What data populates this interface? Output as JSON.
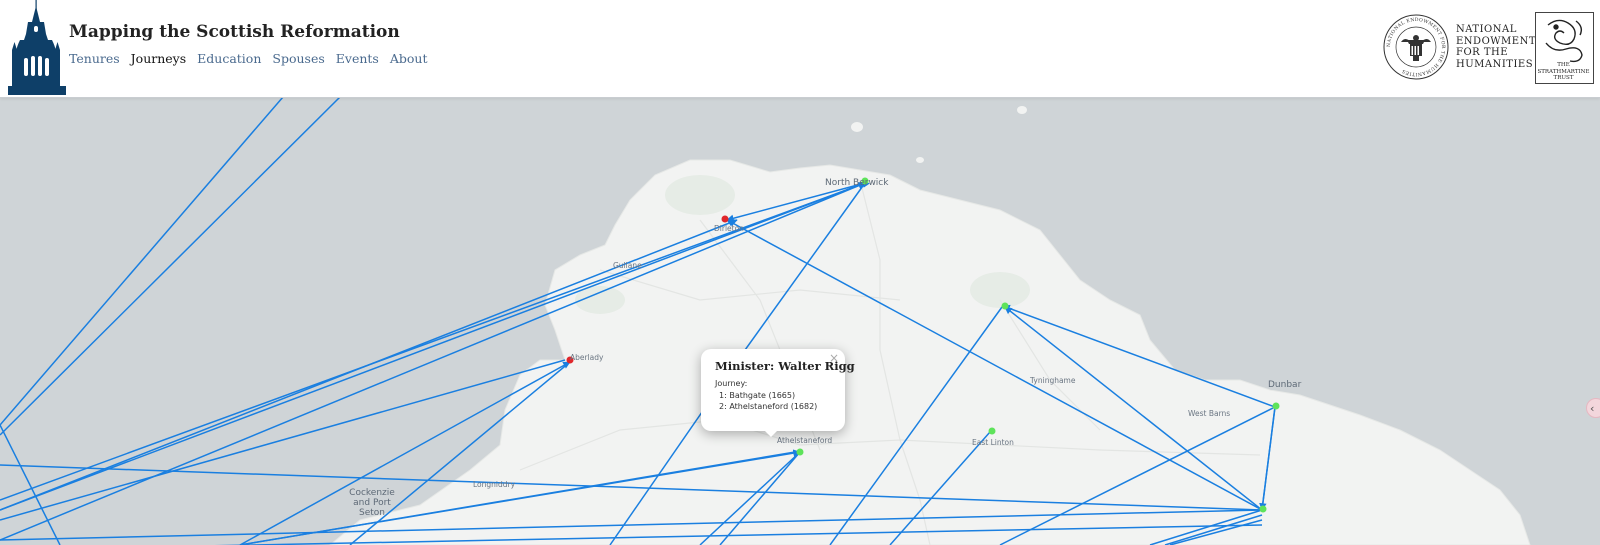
{
  "header": {
    "site_title": "Mapping the Scottish Reformation",
    "nav": [
      {
        "label": "Tenures",
        "active": false
      },
      {
        "label": "Journeys",
        "active": true
      },
      {
        "label": "Education",
        "active": false
      },
      {
        "label": "Spouses",
        "active": false
      },
      {
        "label": "Events",
        "active": false
      },
      {
        "label": "About",
        "active": false
      }
    ],
    "partners": {
      "neh_name": [
        "NATIONAL",
        "ENDOWMENT",
        "FOR THE",
        "HUMANITIES"
      ],
      "neh_seal_text": "NATIONAL ENDOWMENT FOR THE HUMANITIES",
      "strath_caption": [
        "THE",
        "STRATHMARTINE",
        "TRUST"
      ]
    }
  },
  "map": {
    "place_labels": {
      "north_berwick": "North Berwick",
      "dirleton": "Dirleton",
      "gullane": "Gullane",
      "aberlady": "Aberlady",
      "tyninghame": "Tyninghame",
      "dunbar": "Dunbar",
      "west_barns": "West Barns",
      "east_linton": "East Linton",
      "athelstaneford": "Athelstaneford",
      "longniddry": "Longniddry",
      "cockenzie": "Cockenzie and Port Seton"
    },
    "colors": {
      "sea": "#cfd4d7",
      "land": "#f2f3f2",
      "route": "#1a7fe0",
      "marker_green": "#5ee35a",
      "marker_red": "#e0262b"
    },
    "popup": {
      "title": "Minister: Walter Rigg",
      "close": "×",
      "journey_label": "Journey:",
      "stops": [
        "1: Bathgate (1665)",
        "2: Athelstaneford (1682)"
      ]
    },
    "side_toggle_icon": "chevron-left-icon",
    "side_toggle_glyph": "‹"
  }
}
